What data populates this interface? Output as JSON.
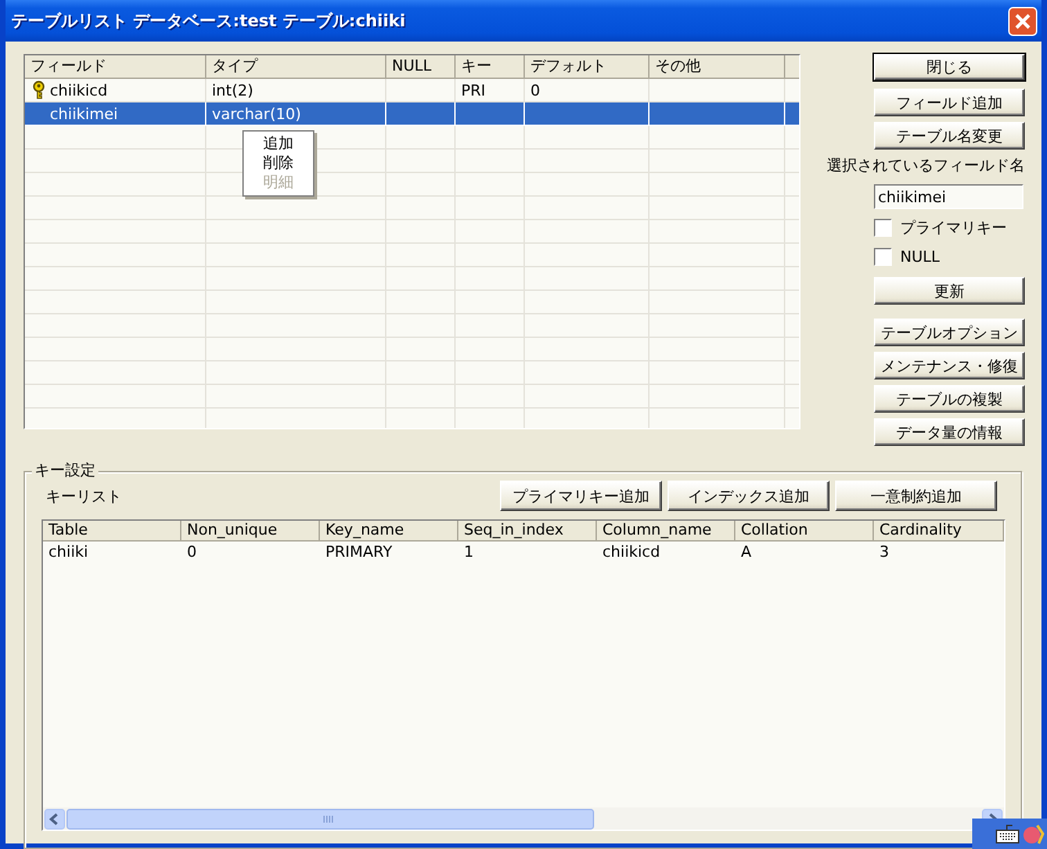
{
  "window": {
    "title": "テーブルリスト  データベース:test テーブル:chiiki"
  },
  "fields": {
    "columns": [
      "フィールド",
      "タイプ",
      "NULL",
      "キー",
      "デフォルト",
      "その他"
    ],
    "rows": [
      {
        "field": "chiikicd",
        "type": "int(2)",
        "key": "PRI",
        "default": "0",
        "primary_key_icon": true,
        "selected": false
      },
      {
        "field": "chiikimei",
        "type": "varchar(10)",
        "primary_key_icon": false,
        "selected": true
      }
    ]
  },
  "context_menu": {
    "items": [
      {
        "label": "追加",
        "disabled": false
      },
      {
        "label": "削除",
        "disabled": false
      },
      {
        "label": "明細",
        "disabled": true
      }
    ]
  },
  "side_panel": {
    "top_buttons": [
      {
        "label": "閉じる",
        "default": true
      },
      {
        "label": "フィールド追加",
        "default": false
      },
      {
        "label": "テーブル名変更",
        "default": false
      }
    ],
    "selected_field": {
      "label": "選択されているフィールド名",
      "value": "chiikimei"
    },
    "checkboxes": [
      {
        "label": "プライマリキー",
        "checked": false
      },
      {
        "label": "NULL",
        "checked": false
      }
    ],
    "update_button": "更新",
    "bottom_buttons": [
      "テーブルオプション",
      "メンテナンス・修復",
      "テーブルの複製",
      "データ量の情報"
    ]
  },
  "key_settings": {
    "title": "キー設定",
    "list_label": "キーリスト",
    "buttons": [
      "プライマリキー追加",
      "インデックス追加",
      "一意制約追加"
    ],
    "table": {
      "columns": [
        "Table",
        "Non_unique",
        "Key_name",
        "Seq_in_index",
        "Column_name",
        "Collation",
        "Cardinality"
      ],
      "rows": [
        [
          "chiiki",
          "0",
          "PRIMARY",
          "1",
          "chiikicd",
          "A",
          "3"
        ]
      ]
    }
  }
}
